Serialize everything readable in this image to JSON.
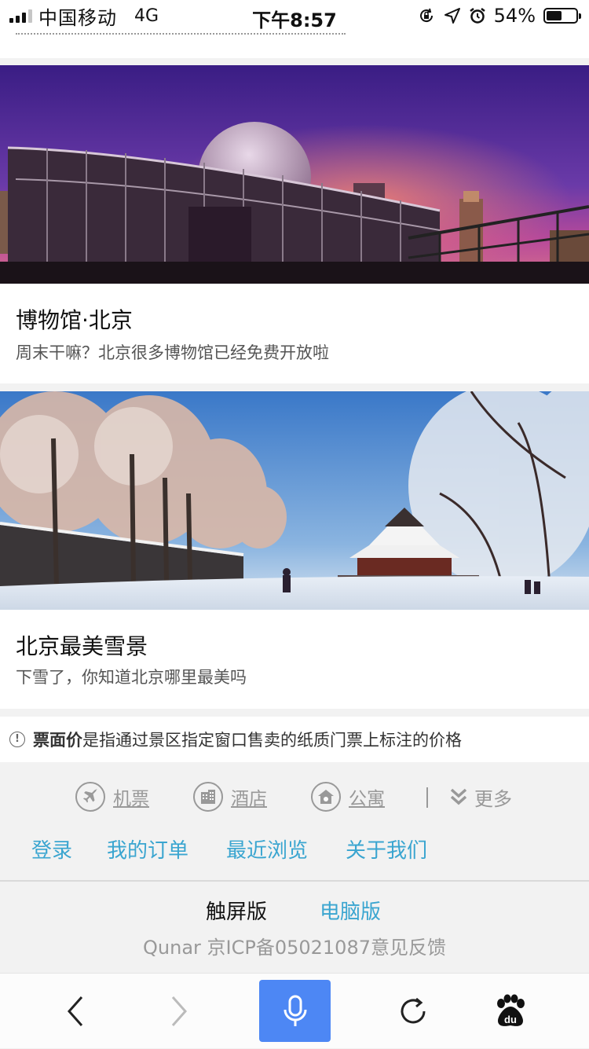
{
  "status_bar": {
    "carrier": "中国移动",
    "network": "4G",
    "time": "下午8:57",
    "battery_percent": "54%",
    "battery_level": 0.54,
    "icons": [
      "signal-bars-icon",
      "orientation-lock-icon",
      "location-arrow-icon",
      "alarm-clock-icon",
      "battery-icon"
    ]
  },
  "cards": [
    {
      "image": "planetarium-night-photo",
      "title": "博物馆·北京",
      "description": "周末干嘛？北京很多博物馆已经免费开放啦"
    },
    {
      "image": "snowy-beijing-park-photo",
      "title": "北京最美雪景",
      "description": "下雪了，你知道北京哪里最美吗"
    }
  ],
  "notice": {
    "icon": "info-icon",
    "strong": "票面价",
    "text": "是指通过景区指定窗口售卖的纸质门票上标注的价格"
  },
  "footer": {
    "services": [
      {
        "label": "机票",
        "icon": "airplane-icon"
      },
      {
        "label": "酒店",
        "icon": "hotel-building-icon"
      },
      {
        "label": "公寓",
        "icon": "apartment-house-icon"
      }
    ],
    "more": {
      "label": "更多",
      "icon": "double-chevron-down-icon"
    },
    "links": [
      "登录",
      "我的订单",
      "最近浏览",
      "关于我们"
    ],
    "versions": {
      "touch": "触屏版",
      "pc": "电脑版"
    },
    "icp": "Qunar 京ICP备05021087意见反馈"
  },
  "toolbar": {
    "icons": [
      "back-arrow-icon",
      "forward-arrow-icon",
      "microphone-icon",
      "refresh-icon",
      "baidu-paw-icon"
    ],
    "baidu_label": "du"
  },
  "colors": {
    "link": "#3aa5d0",
    "mic_button": "#4d87f4",
    "page_background": "#f2f2f2"
  }
}
